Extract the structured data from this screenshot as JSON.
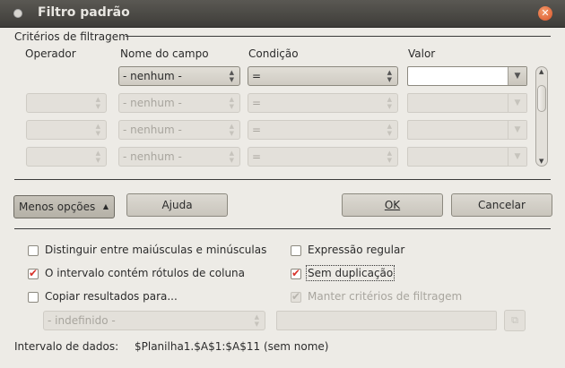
{
  "window": {
    "title": "Filtro padrão"
  },
  "criteria": {
    "section_title": "Critérios de filtragem",
    "headers": {
      "operator": "Operador",
      "field": "Nome do campo",
      "condition": "Condição",
      "value": "Valor"
    },
    "rows": [
      {
        "operator": "",
        "field": "- nenhum -",
        "condition": "=",
        "value": "",
        "enabled": true
      },
      {
        "operator": "",
        "field": "- nenhum -",
        "condition": "=",
        "value": "",
        "enabled": false
      },
      {
        "operator": "",
        "field": "- nenhum -",
        "condition": "=",
        "value": "",
        "enabled": false
      },
      {
        "operator": "",
        "field": "- nenhum -",
        "condition": "=",
        "value": "",
        "enabled": false
      }
    ]
  },
  "buttons": {
    "less_options": "Menos opções",
    "help": "Ajuda",
    "ok": "OK",
    "cancel": "Cancelar"
  },
  "options": {
    "case_sensitive": {
      "label": "Distinguir entre maiúsculas e minúsculas",
      "checked": false
    },
    "regex": {
      "label": "Expressão regular",
      "checked": false
    },
    "contains_headers": {
      "label": "O intervalo contém rótulos de coluna",
      "checked": true
    },
    "no_duplicates": {
      "label": "Sem duplicação",
      "checked": true
    },
    "copy_results": {
      "label": "Copiar resultados para...",
      "checked": false
    },
    "keep_criteria": {
      "label": "Manter critérios de filtragem",
      "checked": true,
      "enabled": false
    },
    "copy_target_select": "- indefinido -",
    "copy_target_input": ""
  },
  "data_range": {
    "label": "Intervalo de dados:",
    "value": "$Planilha1.$A$1:$A$11 (sem nome)"
  },
  "colors": {
    "titlebar": "#3e3d39",
    "check_accent": "#d8342c",
    "close_button": "#d9542a"
  }
}
